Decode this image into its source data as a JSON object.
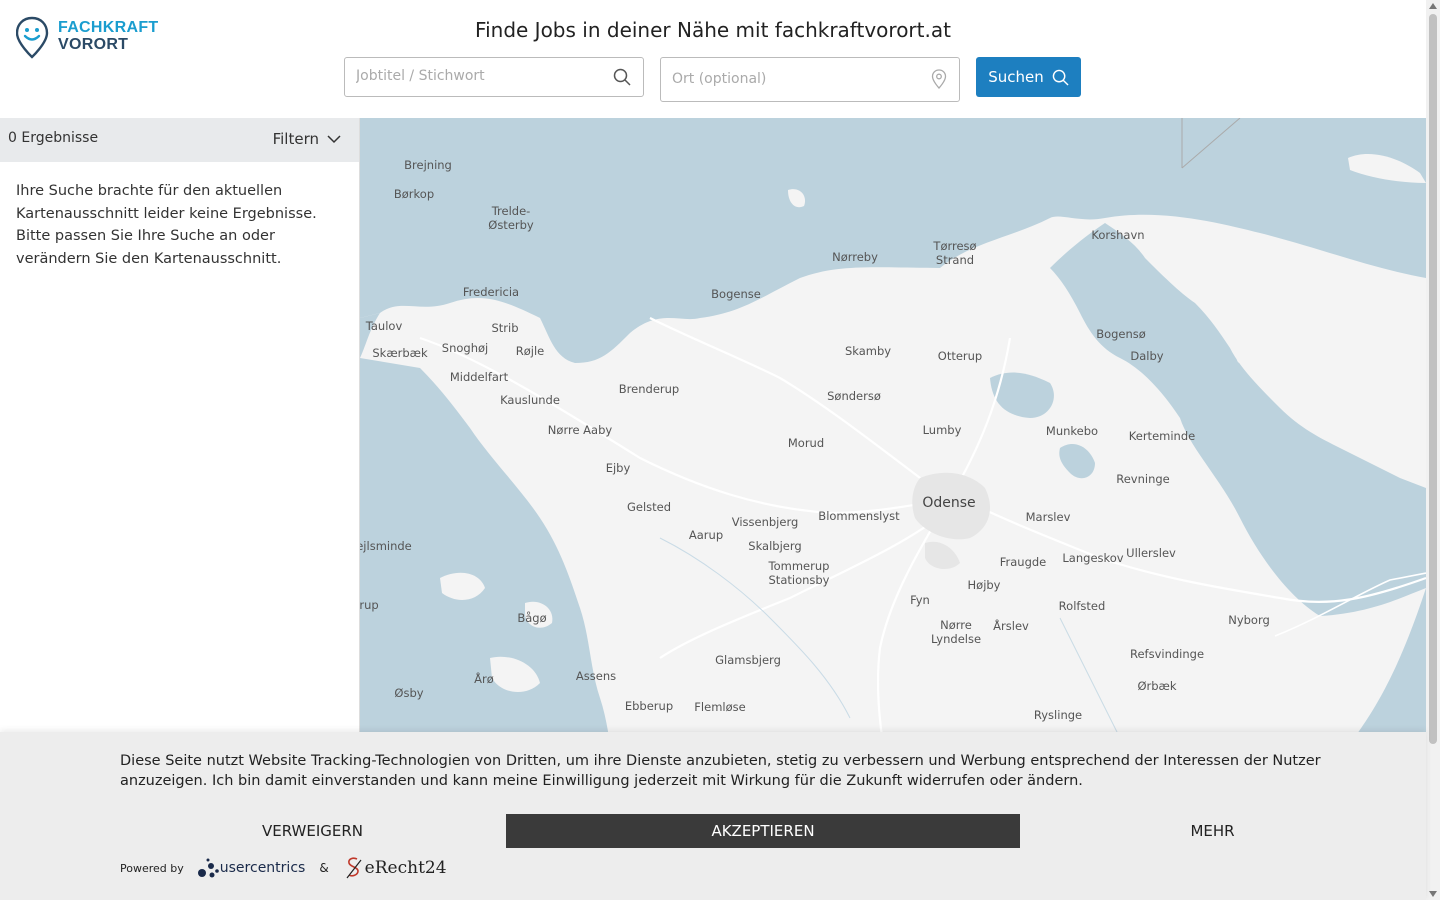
{
  "header": {
    "logo_line1": "FACHKRAFT",
    "logo_line2": "VORORT",
    "headline": "Finde Jobs in deiner Nähe mit fachkraftvorort.at",
    "search_placeholder": "Jobtitel / Stichwort",
    "location_placeholder": "Ort (optional)",
    "search_button": "Suchen",
    "brand_color": "#1d7fc0"
  },
  "sidebar": {
    "result_count": "0 Ergebnisse",
    "filter_label": "Filtern",
    "no_results": "Ihre Suche brachte für den aktuellen Kartenausschnitt leider keine Ergebnisse. Bitte passen Sie Ihre Suche an oder verändern Sie den Kartenausschnitt."
  },
  "map": {
    "places": [
      {
        "name": "Brejning"
      },
      {
        "name": "Børkop"
      },
      {
        "name": "Trelde-\nØsterby"
      },
      {
        "name": "Fredericia"
      },
      {
        "name": "Taulov"
      },
      {
        "name": "Skærbæk"
      },
      {
        "name": "Snoghøj"
      },
      {
        "name": "Strib"
      },
      {
        "name": "Røjle"
      },
      {
        "name": "Middelfart"
      },
      {
        "name": "Kauslunde"
      },
      {
        "name": "Brenderup"
      },
      {
        "name": "Nørre Aaby"
      },
      {
        "name": "Ejby"
      },
      {
        "name": "Gelsted"
      },
      {
        "name": "Aarup"
      },
      {
        "name": "Vissenbjerg"
      },
      {
        "name": "Skalbjerg"
      },
      {
        "name": "Tommerup\nStationsby"
      },
      {
        "name": "Bogense"
      },
      {
        "name": "Nørreby"
      },
      {
        "name": "Tørresø\nStrand"
      },
      {
        "name": "Korshavn"
      },
      {
        "name": "Bogensø"
      },
      {
        "name": "Dalby"
      },
      {
        "name": "Skamby"
      },
      {
        "name": "Otterup"
      },
      {
        "name": "Søndersø"
      },
      {
        "name": "Morud"
      },
      {
        "name": "Lumby"
      },
      {
        "name": "Munkebo"
      },
      {
        "name": "Kerteminde"
      },
      {
        "name": "Odense"
      },
      {
        "name": "Blommenslyst"
      },
      {
        "name": "Marslev"
      },
      {
        "name": "Revninge"
      },
      {
        "name": "Fraugde"
      },
      {
        "name": "Langeskov"
      },
      {
        "name": "Ullerslev"
      },
      {
        "name": "Højby"
      },
      {
        "name": "Fyn"
      },
      {
        "name": "Nørre\nLyndelse"
      },
      {
        "name": "Årslev"
      },
      {
        "name": "Rolfsted"
      },
      {
        "name": "Nyborg"
      },
      {
        "name": "Refsvindinge"
      },
      {
        "name": "Ørbæk"
      },
      {
        "name": "Ryslinge"
      },
      {
        "name": "Glamsbjerg"
      },
      {
        "name": "Assens"
      },
      {
        "name": "Ebberup"
      },
      {
        "name": "Flemløse"
      },
      {
        "name": "Bågø"
      },
      {
        "name": "Årø"
      },
      {
        "name": "Øsby"
      },
      {
        "name": "ejlsminde"
      },
      {
        "name": "rup"
      }
    ],
    "water_color": "#bcd2dd",
    "land_color": "#f4f4f4"
  },
  "cookie": {
    "text": "Diese Seite nutzt Website Tracking-Technologien von Dritten, um ihre Dienste anzubieten, stetig zu verbessern und Werbung entsprechend der Interessen der Nutzer anzuzeigen. Ich bin damit einverstanden und kann meine Einwilligung jederzeit mit Wirkung für die Zukunft widerrufen oder ändern.",
    "deny": "VERWEIGERN",
    "accept": "AKZEPTIEREN",
    "more": "MEHR",
    "powered_by": "Powered by",
    "usercentrics": "usercentrics",
    "amp": "&",
    "erecht": "eRecht24"
  }
}
